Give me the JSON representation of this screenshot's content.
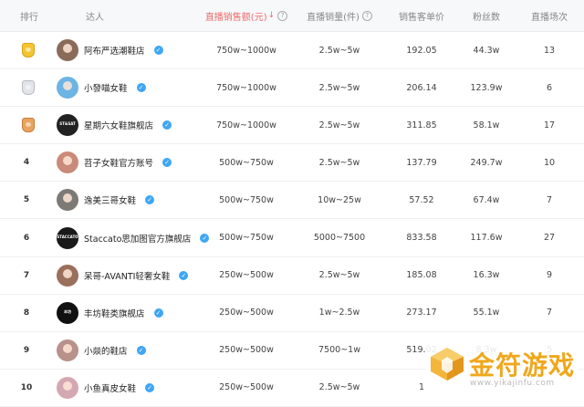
{
  "header": {
    "rank": "排行",
    "talent": "达人",
    "sales_amount": "直播销售额(元)",
    "sales_volume": "直播销量(件)",
    "unit_price": "销售客单价",
    "fans": "粉丝数",
    "live_count": "直播场次"
  },
  "rows": [
    {
      "rank": "",
      "medal": "gold",
      "name": "阿布严选潮鞋店",
      "sales_amount": "750w~1000w",
      "sales_volume": "2.5w~5w",
      "unit_price": "192.05",
      "fans": "44.3w",
      "live_count": "13",
      "avatar_color": "#8a6b5a"
    },
    {
      "rank": "",
      "medal": "silver",
      "name": "小發喵女鞋",
      "sales_amount": "750w~1000w",
      "sales_volume": "2.5w~5w",
      "unit_price": "206.14",
      "fans": "123.9w",
      "live_count": "6",
      "avatar_color": "#6cb4e4"
    },
    {
      "rank": "",
      "medal": "bronze",
      "name": "星期六女鞋旗舰店",
      "sales_amount": "750w~1000w",
      "sales_volume": "2.5w~5w",
      "unit_price": "311.85",
      "fans": "58.1w",
      "live_count": "17",
      "avatar_color": "#222222",
      "avatar_text": "ST&SAT"
    },
    {
      "rank": "4",
      "medal": "",
      "name": "苕子女鞋官方账号",
      "sales_amount": "500w~750w",
      "sales_volume": "2.5w~5w",
      "unit_price": "137.79",
      "fans": "249.7w",
      "live_count": "10",
      "avatar_color": "#c98a7a"
    },
    {
      "rank": "5",
      "medal": "",
      "name": "逸美三哥女鞋",
      "sales_amount": "500w~750w",
      "sales_volume": "10w~25w",
      "unit_price": "57.52",
      "fans": "67.4w",
      "live_count": "7",
      "avatar_color": "#7d7a76"
    },
    {
      "rank": "6",
      "medal": "",
      "name": "Staccato思加图官方旗舰店",
      "sales_amount": "500w~750w",
      "sales_volume": "5000~7500",
      "unit_price": "833.58",
      "fans": "117.6w",
      "live_count": "27",
      "avatar_color": "#1a1a1a",
      "avatar_text": "STACCATO"
    },
    {
      "rank": "7",
      "medal": "",
      "name": "呆哥-AVANTI轻奢女鞋",
      "sales_amount": "250w~500w",
      "sales_volume": "2.5w~5w",
      "unit_price": "185.08",
      "fans": "16.3w",
      "live_count": "9",
      "avatar_color": "#9a6f5c"
    },
    {
      "rank": "8",
      "medal": "",
      "name": "丰坊鞋类旗舰店",
      "sales_amount": "250w~500w",
      "sales_volume": "1w~2.5w",
      "unit_price": "273.17",
      "fans": "55.1w",
      "live_count": "7",
      "avatar_color": "#111111",
      "avatar_text": "丰坊"
    },
    {
      "rank": "9",
      "medal": "",
      "name": "小燚的鞋店",
      "sales_amount": "250w~500w",
      "sales_volume": "7500~1w",
      "unit_price": "519.02",
      "fans": "8.3w",
      "live_count": "5",
      "avatar_color": "#b8918a"
    },
    {
      "rank": "10",
      "medal": "",
      "name": "小鱼真皮女鞋",
      "sales_amount": "250w~500w",
      "sales_volume": "2.5w~5w",
      "unit_price": "1",
      "fans": "",
      "live_count": "",
      "avatar_color": "#d4a8b2"
    }
  ],
  "watermark": {
    "text": "金符游戏",
    "url": "www.yikajinfu.com"
  },
  "colors": {
    "accent_red": "#f06a6a",
    "verify_blue": "#3ea6f5",
    "watermark_orange": "#f0a71c"
  }
}
